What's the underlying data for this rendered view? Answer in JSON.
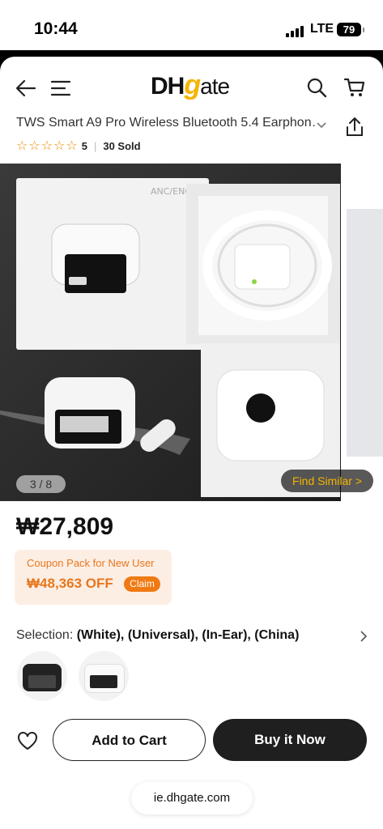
{
  "status_bar": {
    "time": "10:44",
    "network": "LTE",
    "battery": "79"
  },
  "header": {
    "logo_text": "DHgate",
    "logo_dh": "DH",
    "logo_g": "g",
    "logo_ate": "ate"
  },
  "product": {
    "title": "TWS Smart A9 Pro Wireless Bluetooth 5.4 Earphon…",
    "rating": "5",
    "sold": "30 Sold",
    "gallery_counter": "3 / 8",
    "find_similar": "Find Similar >",
    "image_box_text": "ANC/ENC",
    "price": "₩27,809"
  },
  "coupon": {
    "label": "Coupon Pack for New User",
    "amount": "₩48,363 OFF",
    "claim": "Claim"
  },
  "selection": {
    "label": "Selection:",
    "value": "(White), (Universal), (In-Ear), (China)",
    "variants": [
      {
        "name": "black"
      },
      {
        "name": "white"
      }
    ]
  },
  "actions": {
    "add_to_cart": "Add to Cart",
    "buy_now": "Buy it Now"
  },
  "browser": {
    "url": "ie.dhgate.com"
  },
  "colors": {
    "accent": "#f07a12",
    "stars": "#f08a00",
    "logo_yellow": "#f5b400",
    "dark_button": "#1f1f1f"
  }
}
